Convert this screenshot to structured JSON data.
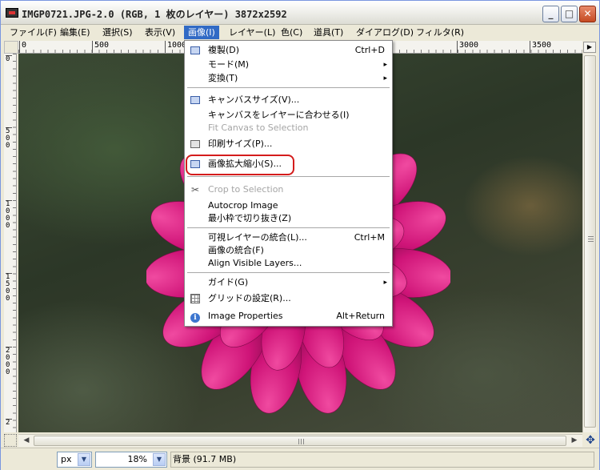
{
  "window": {
    "title": "IMGP0721.JPG-2.0 (RGB, 1 枚のレイヤー) 3872x2592",
    "min_glyph": "_",
    "max_glyph": "□",
    "close_glyph": "✕"
  },
  "menubar": {
    "items": [
      "ファイル(F)",
      "編集(E)",
      "選択(S)",
      "表示(V)",
      "画像(I)",
      "レイヤー(L)",
      "色(C)",
      "道具(T)",
      "ダイアログ(D)",
      "フィルタ(R)"
    ]
  },
  "rulers": {
    "h_labels": [
      "0",
      "500",
      "1000",
      "3000",
      "3500"
    ],
    "v_labels": [
      "0",
      "500",
      "1000",
      "1500",
      "2000",
      "2"
    ]
  },
  "image_menu": {
    "items": [
      {
        "label": "複製(D)",
        "shortcut": "Ctrl+D",
        "icon": "duplicate-icon"
      },
      {
        "label": "モード(M)",
        "submenu": "▸"
      },
      {
        "label": "変換(T)",
        "submenu": "▸"
      },
      {
        "label": "キャンバスサイズ(V)...",
        "icon": "canvas-size-icon"
      },
      {
        "label": "キャンバスをレイヤーに合わせる(I)"
      },
      {
        "label": "Fit Canvas to Selection"
      },
      {
        "label": "印刷サイズ(P)...",
        "icon": "print-size-icon"
      },
      {
        "label": "画像拡大縮小(S)...",
        "icon": "scale-image-icon"
      },
      {
        "label": "Crop to Selection",
        "icon": "crop-icon"
      },
      {
        "label": "Autocrop Image"
      },
      {
        "label": "最小枠で切り抜き(Z)"
      },
      {
        "label": "可視レイヤーの統合(L)...",
        "shortcut": "Ctrl+M"
      },
      {
        "label": "画像の統合(F)"
      },
      {
        "label": "Align Visible Layers..."
      },
      {
        "label": "ガイド(G)",
        "submenu": "▸"
      },
      {
        "label": "グリッドの設定(R)...",
        "icon": "grid-icon"
      },
      {
        "label": "Image Properties",
        "shortcut": "Alt+Return",
        "icon": "info-icon"
      }
    ]
  },
  "statusbar": {
    "unit": "px",
    "zoom": "18%",
    "status": "背景 (91.7 MB)"
  },
  "colors": {
    "menu_highlight": "#316ac5",
    "annotation_ring": "#d41c1c",
    "flower": "#d11a78"
  }
}
